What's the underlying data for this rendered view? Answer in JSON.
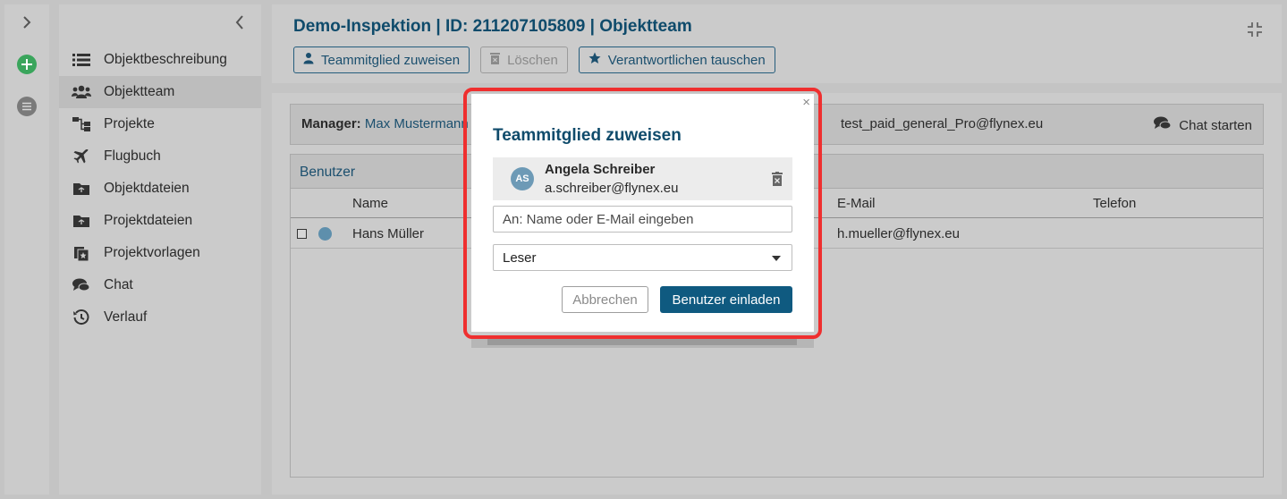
{
  "header": {
    "title": "Demo-Inspektion | ID: 211207105809 | Objektteam",
    "assign_label": "Teammitglied zuweisen",
    "delete_label": "Löschen",
    "swap_label": "Verantwortlichen tauschen"
  },
  "sidebar": {
    "items": [
      {
        "label": "Objektbeschreibung",
        "icon": "list-icon"
      },
      {
        "label": "Objektteam",
        "icon": "team-icon",
        "active": true
      },
      {
        "label": "Projekte",
        "icon": "hierarchy-icon"
      },
      {
        "label": "Flugbuch",
        "icon": "plane-icon"
      },
      {
        "label": "Objektdateien",
        "icon": "folder-icon"
      },
      {
        "label": "Projektdateien",
        "icon": "folder-icon"
      },
      {
        "label": "Projektvorlagen",
        "icon": "template-icon"
      },
      {
        "label": "Chat",
        "icon": "chat-icon"
      },
      {
        "label": "Verlauf",
        "icon": "history-icon"
      }
    ]
  },
  "manager": {
    "label": "Manager:",
    "name": "Max Mustermann",
    "email": "test_paid_general_Pro@flynex.eu",
    "chat_label": "Chat starten"
  },
  "users": {
    "title": "Benutzer",
    "columns": {
      "name": "Name",
      "email": "E-Mail",
      "phone": "Telefon"
    },
    "rows": [
      {
        "name": "Hans Müller",
        "email": "h.mueller@flynex.eu",
        "phone": ""
      }
    ]
  },
  "modal": {
    "title": "Teammitglied zuweisen",
    "close": "×",
    "selected": {
      "initials": "AS",
      "name": "Angela Schreiber",
      "email": "a.schreiber@flynex.eu"
    },
    "input_placeholder": "An: Name oder E-Mail eingeben",
    "role_value": "Leser",
    "cancel_label": "Abbrechen",
    "invite_label": "Benutzer einladen"
  },
  "colors": {
    "accent": "#0f5a80",
    "title": "#0f4b6b",
    "highlight": "#ef2f2f",
    "add": "#3aa55c"
  }
}
